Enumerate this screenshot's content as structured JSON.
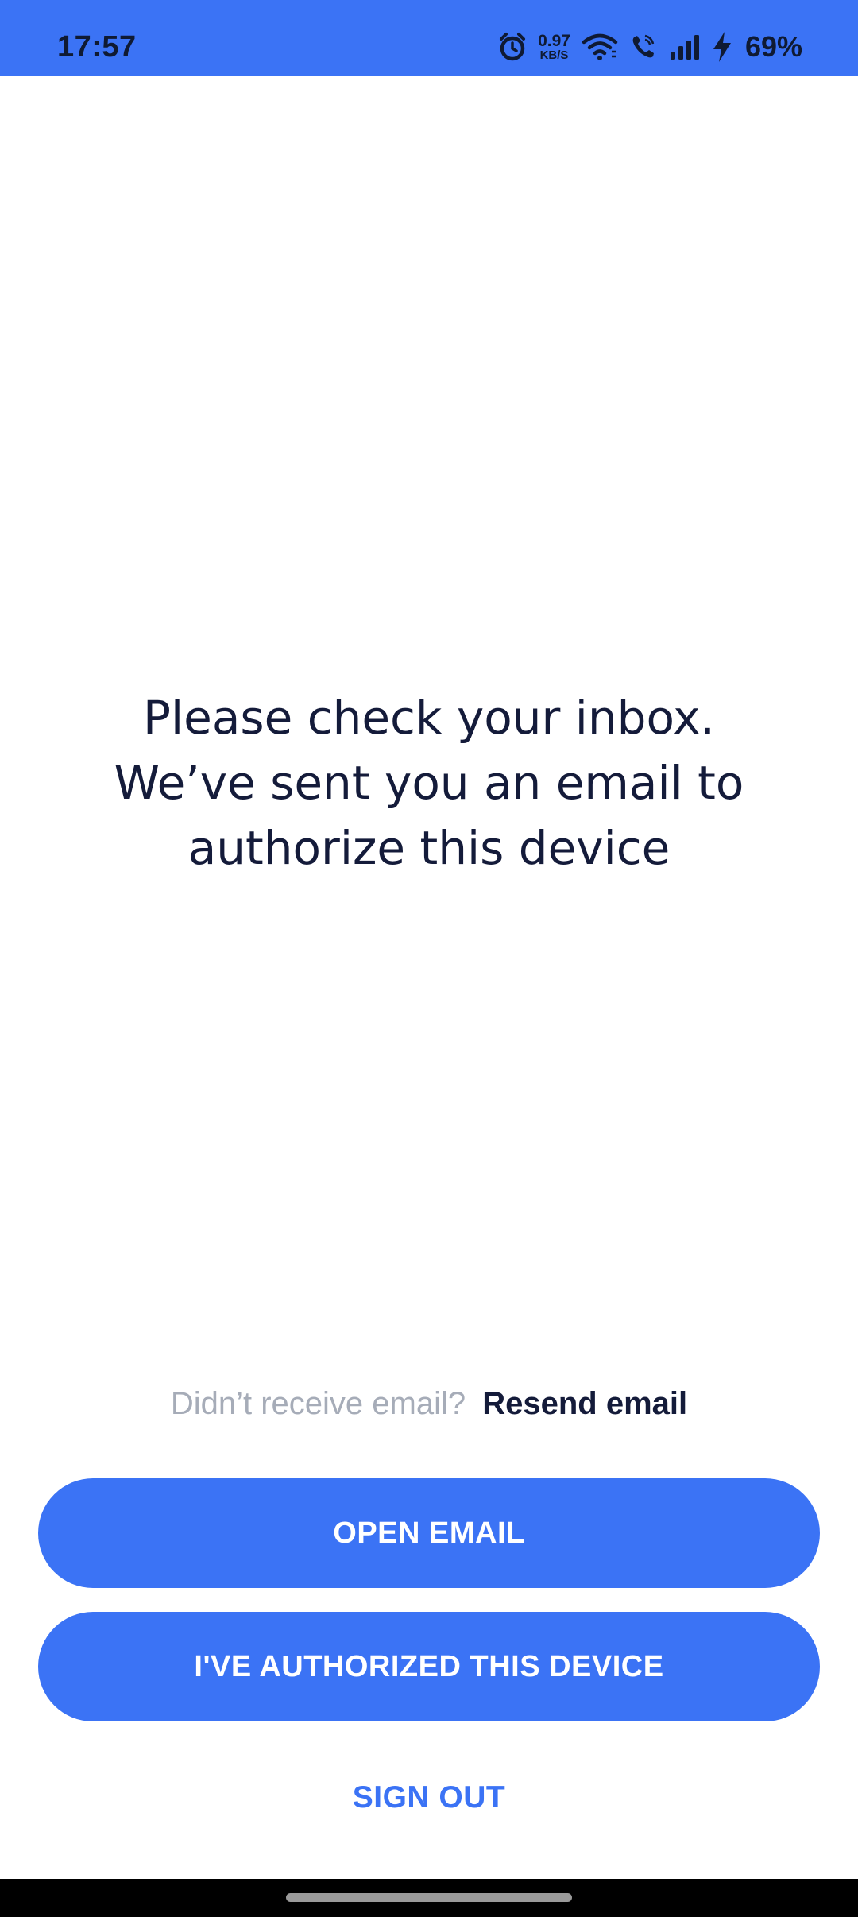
{
  "status_bar": {
    "time": "17:57",
    "speed_value": "0.97",
    "speed_unit": "KB/S",
    "battery_percent": "69%",
    "icons": [
      "alarm-icon",
      "wifi-icon",
      "wifi-calling-icon",
      "signal-icon",
      "charging-icon"
    ],
    "background_color": "#3b73f5"
  },
  "message": {
    "line1": "Please check your inbox.",
    "line2": "We’ve sent you an email to",
    "line3": "authorize this device"
  },
  "resend": {
    "question": "Didn’t receive email?",
    "link_label": "Resend email"
  },
  "buttons": {
    "open_email": "OPEN EMAIL",
    "authorized": "I'VE AUTHORIZED THIS DEVICE",
    "sign_out": "SIGN OUT"
  },
  "colors": {
    "accent": "#3b73f5",
    "text_primary": "#141b3a",
    "text_muted": "#a6acb8"
  }
}
